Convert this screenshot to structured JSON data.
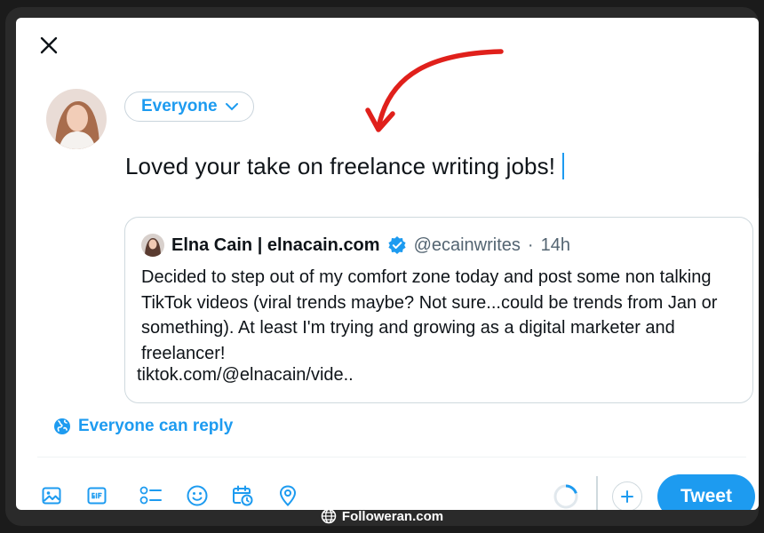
{
  "composer": {
    "audience_label": "Everyone",
    "text": "Loved your take on freelance writing jobs!",
    "reply_setting": "Everyone can reply",
    "tweet_button": "Tweet"
  },
  "quoted_tweet": {
    "author_name": "Elna Cain | elnacain.com",
    "handle": "@ecainwrites",
    "separator": "·",
    "time": "14h",
    "body": "Decided to step out of my comfort zone today and post some non talking TikTok videos (viral trends maybe? Not sure...could be trends from Jan or something). At least I'm trying and growing as a digital marketer and freelancer!",
    "link": "tiktok.com/@elnacain/vide.."
  },
  "toolbar": {
    "icons": [
      "image-icon",
      "gif-icon",
      "poll-icon",
      "emoji-icon",
      "schedule-icon",
      "location-icon"
    ]
  },
  "footer": {
    "watermark": "Followeran.com"
  },
  "colors": {
    "accent": "#1d9bf0",
    "annotation_arrow": "#e0201b",
    "text": "#0f1419",
    "muted": "#536471"
  }
}
